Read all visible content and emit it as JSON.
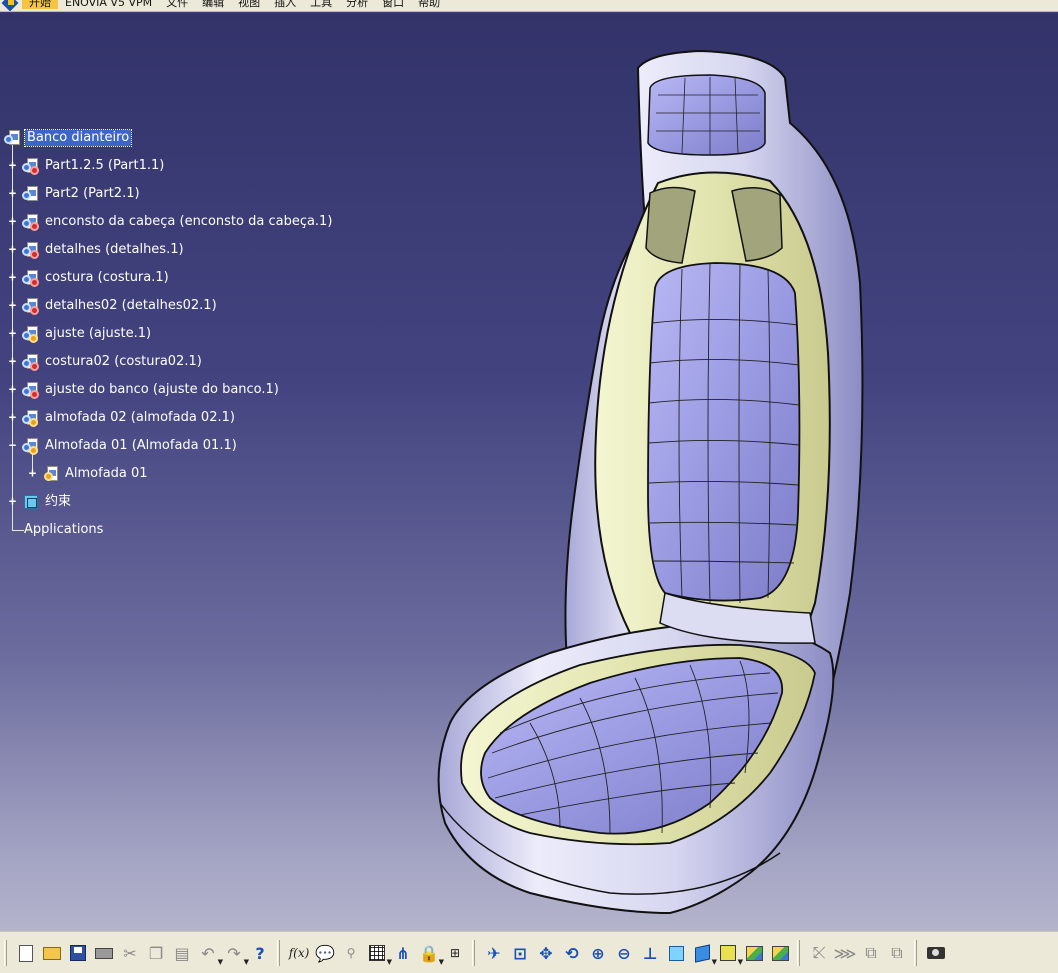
{
  "menubar": {
    "items": [
      "开始",
      "ENOVIA V5 VPM",
      "文件",
      "编辑",
      "视图",
      "插入",
      "工具",
      "分析",
      "窗口",
      "帮助"
    ]
  },
  "tree": {
    "root": "Banco dianteiro",
    "children": [
      "Part1.2.5 (Part1.1)",
      "Part2 (Part2.1)",
      "enconsto da cabeça (enconsto da cabeça.1)",
      "detalhes (detalhes.1)",
      "costura (costura.1)",
      "detalhes02 (detalhes02.1)",
      "ajuste (ajuste.1)",
      "costura02 (costura02.1)",
      "ajuste do banco (ajuste do banco.1)",
      "almofada 02 (almofada 02.1)",
      "Almofada 01 (Almofada 01.1)"
    ],
    "subchild": "Almofada 01",
    "constraints": "约束",
    "applications": "Applications"
  },
  "colors": {
    "viewport_top": "#33336a",
    "viewport_bottom": "#b4b4cc",
    "seat_shell": "#ccccee",
    "seat_cushion": "#9a9ae0",
    "seat_bolster": "#e6e8b8",
    "selection": "#3b66c7"
  },
  "toolbar": {
    "icons": [
      "new-icon",
      "open-icon",
      "save-icon",
      "print-icon",
      "cut-icon",
      "copy-icon",
      "paste-icon",
      "undo-icon",
      "redo-icon",
      "whats-this-icon",
      "formula-icon",
      "knowledge-icon",
      "light-icon",
      "table-icon",
      "graph-tree-icon",
      "catalog-icon",
      "measure-icon",
      "fly-mode-icon",
      "fit-all-icon",
      "pan-icon",
      "rotate-icon",
      "zoom-in-icon",
      "zoom-out-icon",
      "normal-view-icon",
      "multi-view-icon",
      "iso-view-icon",
      "render-style-icon",
      "hide-show-icon",
      "swap-space-icon",
      "manipulate-icon",
      "snap-icon",
      "explode-icon",
      "stop-manipulate-icon",
      "capture-icon"
    ],
    "formula_glyph": "f(x)"
  }
}
